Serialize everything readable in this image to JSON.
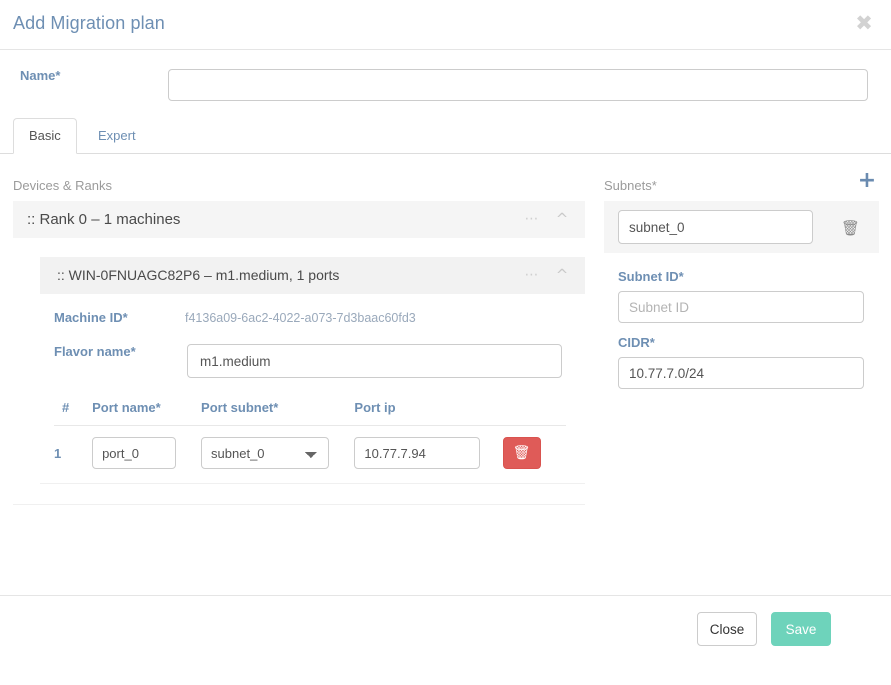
{
  "modal": {
    "title": "Add Migration plan",
    "close_icon": "close-icon"
  },
  "name_field": {
    "label": "Name*",
    "value": "",
    "placeholder": ""
  },
  "tabs": [
    {
      "label": "Basic",
      "active": true
    },
    {
      "label": "Expert",
      "active": false
    }
  ],
  "devices": {
    "section_label": "Devices & Ranks",
    "rank": {
      "title": ":: Rank 0 – 1 machines",
      "dots_icon": "ellipsis-icon",
      "chevron_icon": "chevron-up-icon"
    },
    "machine": {
      "title": ":: WIN-0FNUAGC82P6 – m1.medium, 1 ports",
      "dots_icon": "ellipsis-icon",
      "chevron_icon": "chevron-up-icon",
      "machine_id_label": "Machine ID*",
      "machine_id_value": "f4136a09-6ac2-4022-a073-7d3baac60fd3",
      "flavor_label": "Flavor name*",
      "flavor_value": "m1.medium"
    },
    "ports_table": {
      "headers": [
        "#",
        "Port name*",
        "Port subnet*",
        "Port ip"
      ],
      "rows": [
        {
          "num": "1",
          "port_name": "port_0",
          "port_subnet": "subnet_0",
          "port_subnet_options": [
            "subnet_0"
          ],
          "port_ip": "10.77.7.94",
          "delete_icon": "trash-icon"
        }
      ]
    }
  },
  "subnets": {
    "section_label": "Subnets*",
    "add_icon": "plus-icon",
    "items": [
      {
        "name": "subnet_0",
        "delete_icon": "trash-icon"
      }
    ],
    "subnet_id_label": "Subnet ID*",
    "subnet_id_value": "",
    "subnet_id_placeholder": "Subnet ID",
    "cidr_label": "CIDR*",
    "cidr_value": "10.77.7.0/24"
  },
  "footer": {
    "close_label": "Close",
    "save_label": "Save"
  },
  "colors": {
    "accent_blue": "#6e8fb3",
    "save_green": "#6ed3bb",
    "delete_red": "#df5b58",
    "band_gray": "#f5f5f5"
  }
}
